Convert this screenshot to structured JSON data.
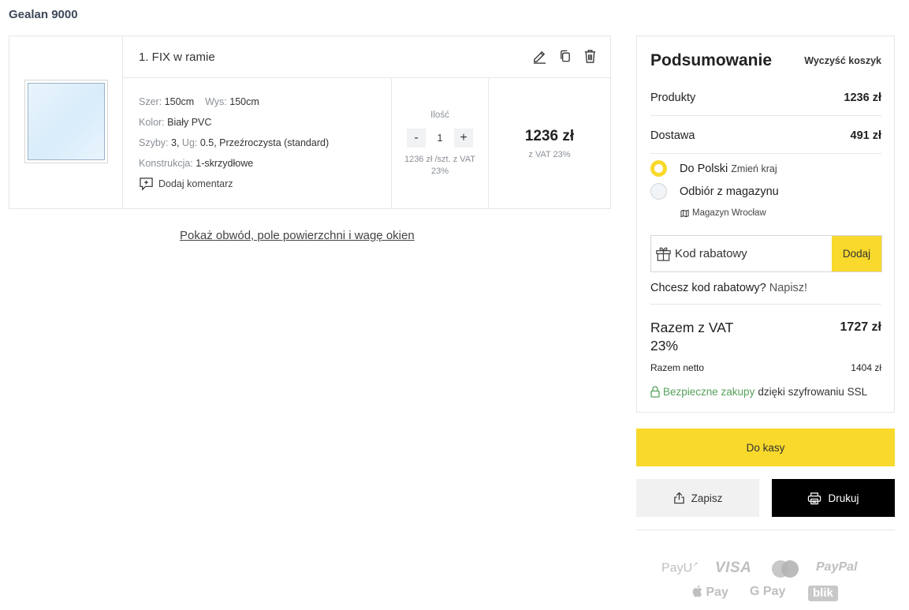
{
  "brand": "Gealan 9000",
  "item": {
    "title": "1. FIX w ramie",
    "specs": {
      "width_label": "Szer:",
      "width_value": "150cm",
      "height_label": "Wys:",
      "height_value": "150cm",
      "color_label": "Kolor:",
      "color_value": "Biały PVC",
      "glass_label": "Szyby:",
      "glass_count": "3,",
      "ug_label": "Ug:",
      "ug_value": "0.5, Przeźroczysta (standard)",
      "construction_label": "Konstrukcja:",
      "construction_value": "1-skrzydłowe"
    },
    "comment_label": "Dodaj komentarz",
    "qty_label": "Ilość",
    "qty_minus": "-",
    "qty_value": "1",
    "qty_plus": "+",
    "unit_price": "1236 zł /szt. z VAT 23%",
    "price": "1236 zł",
    "price_vat": "z VAT 23%"
  },
  "show_link": "Pokaż obwód, pole powierzchni i wagę okien",
  "summary": {
    "title": "Podsumowanie",
    "clear_cart": "Wyczyść koszyk",
    "products_label": "Produkty",
    "products_value": "1236 zł",
    "delivery_label": "Dostawa",
    "delivery_value": "491 zł",
    "option_poland": "Do Polski",
    "change_country": "Zmień kraj",
    "option_pickup": "Odbiór z magazynu",
    "warehouse": "Magazyn Wrocław",
    "coupon_placeholder": "Kod rabatowy",
    "coupon_button": "Dodaj",
    "coupon_question": "Chcesz kod rabatowy?",
    "coupon_link": "Napisz!",
    "total_label": "Razem z VAT 23%",
    "total_value": "1727 zł",
    "net_label": "Razem netto",
    "net_value": "1404 zł",
    "ssl_green": "Bezpieczne zakupy",
    "ssl_rest": "dzięki szyfrowaniu SSL"
  },
  "actions": {
    "checkout": "Do kasy",
    "save": "Zapisz",
    "print": "Drukuj"
  },
  "payments": {
    "payu": "PayU",
    "visa": "VISA",
    "paypal": "PayPal",
    "apple_pay": "Pay",
    "google_pay": "Pay",
    "blik": "blik"
  },
  "colors": {
    "accent_yellow": "#f8d92c",
    "ssl_green": "#55a05a"
  }
}
